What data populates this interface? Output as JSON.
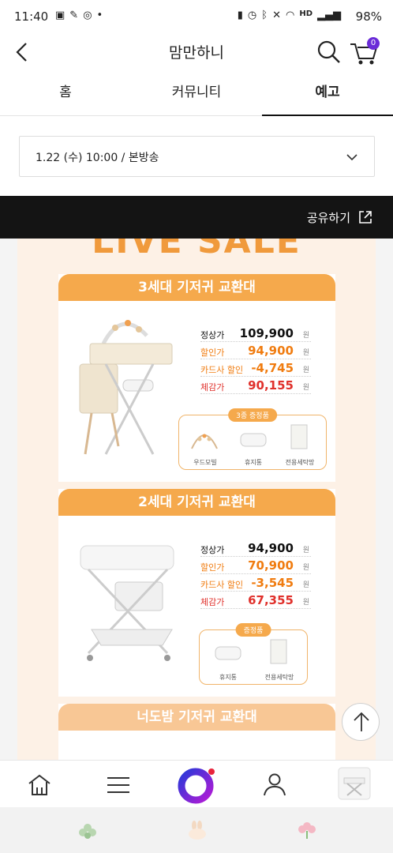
{
  "status_bar": {
    "time": "11:40",
    "network": "HD",
    "battery": "98%"
  },
  "app": {
    "title": "맘만하니",
    "cart_count": "0"
  },
  "tabs": [
    {
      "label": "홈"
    },
    {
      "label": "커뮤니티"
    },
    {
      "label": "예고"
    }
  ],
  "active_tab": "예고",
  "date_select": {
    "value": "1.22 (수) 10:00 / 본방송"
  },
  "share": {
    "label": "공유하기"
  },
  "poster": {
    "headline": "LIVE SALE",
    "products": [
      {
        "name": "3세대 기저귀 교환대",
        "prices": [
          {
            "label": "정상가",
            "value": "109,900",
            "unit": "원"
          },
          {
            "label": "할인가",
            "value": "94,900",
            "unit": "원"
          },
          {
            "label": "카드사 할인",
            "value": "-4,745",
            "unit": "원"
          },
          {
            "label": "체감가",
            "value": "90,155",
            "unit": "원"
          }
        ],
        "gift_title": "3종 증정품",
        "gifts": [
          "우드모빌",
          "휴지통",
          "전용세탁망"
        ]
      },
      {
        "name": "2세대 기저귀 교환대",
        "prices": [
          {
            "label": "정상가",
            "value": "94,900",
            "unit": "원"
          },
          {
            "label": "할인가",
            "value": "70,900",
            "unit": "원"
          },
          {
            "label": "카드사 할인",
            "value": "-3,545",
            "unit": "원"
          },
          {
            "label": "체감가",
            "value": "67,355",
            "unit": "원"
          }
        ],
        "gift_title": "증정품",
        "gifts": [
          "휴지통",
          "전용세탁망"
        ]
      },
      {
        "name": "너도밤 기저귀 교환대"
      }
    ]
  },
  "colors": {
    "accent": "#f5a94c",
    "sale_red": "#e0312c",
    "discount_orange": "#f07c10",
    "dark_bar": "#141414",
    "live_purple": "#6a2bd8"
  }
}
